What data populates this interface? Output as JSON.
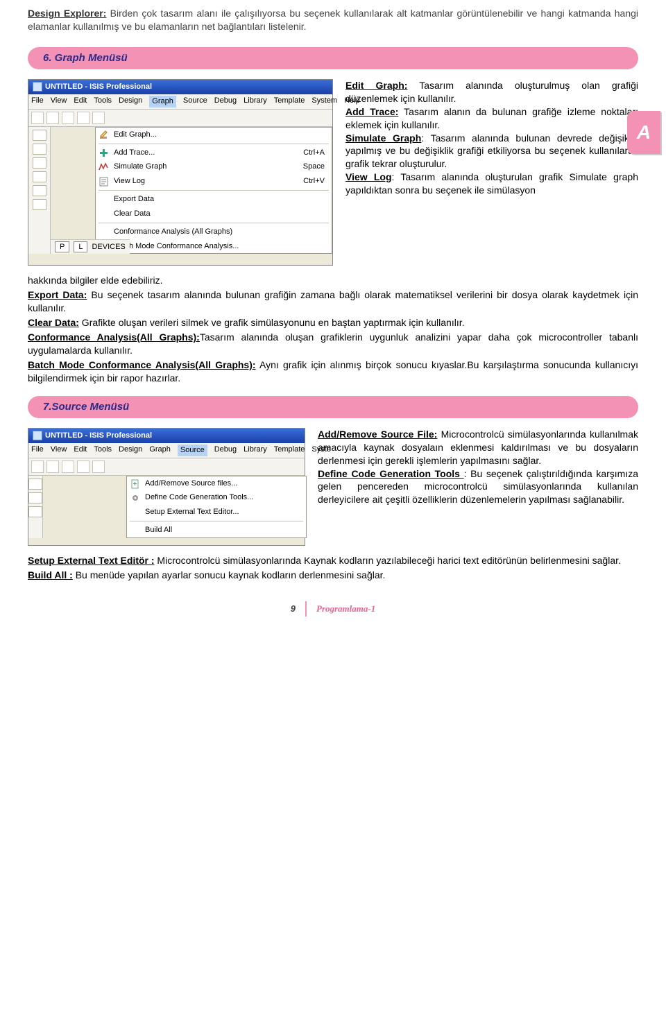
{
  "intro": {
    "term": "Design Explorer:",
    "text": " Birden çok tasarım alanı ile çalışılıyorsa  bu seçenek kullanılarak alt katmanlar görüntülenebilir ve hangi katmanda hangi elamanlar kullanılmış  ve bu elamanların net bağlantıları listelenir."
  },
  "tabA": "A",
  "section6": {
    "heading": "6. Graph  Menüsü",
    "screenshot": {
      "title": "UNTITLED - ISIS Professional",
      "menus": [
        "File",
        "View",
        "Edit",
        "Tools",
        "Design",
        "Graph",
        "Source",
        "Debug",
        "Library",
        "Template",
        "System",
        "Help"
      ],
      "menuSelected": "Graph",
      "dropdown": [
        {
          "icon": "edit",
          "label": "Edit Graph...",
          "shortcut": ""
        },
        {
          "sep": true
        },
        {
          "icon": "plus",
          "label": "Add Trace...",
          "shortcut": "Ctrl+A"
        },
        {
          "icon": "sim",
          "label": "Simulate Graph",
          "shortcut": "Space"
        },
        {
          "icon": "log",
          "label": "View Log",
          "shortcut": "Ctrl+V"
        },
        {
          "sep": true
        },
        {
          "icon": "",
          "label": "Export Data",
          "shortcut": ""
        },
        {
          "icon": "",
          "label": "Clear Data",
          "shortcut": ""
        },
        {
          "sep": true
        },
        {
          "icon": "",
          "label": "Conformance Analysis (All Graphs)",
          "shortcut": ""
        },
        {
          "icon": "",
          "label": "Batch Mode Conformance Analysis...",
          "shortcut": ""
        }
      ],
      "dev_p": "P",
      "dev_l": "L",
      "dev_label": "DEVICES"
    },
    "rightDesc": {
      "p1_term": "Edit Graph:",
      "p1": " Tasarım alanında oluşturulmuş olan grafiği düzenlemek için kullanılır.",
      "p2_term": "Add Trace:",
      "p2": " Tasarım alanın da bulunan grafiğe izleme noktaları eklemek için kullanılır.",
      "p3_term": "Simulate Graph",
      "p3": ": Tasarım alanında bulunan devrede değişiklik yapılmış ve bu değişiklik grafiği etkiliyorsa bu seçenek kullanılarak grafik tekrar oluşturulur.",
      "p4_term": "View Log",
      "p4": ": Tasarım alanında oluşturulan grafik Simulate graph yapıldıktan sonra bu seçenek ile simülasyon"
    },
    "cont_line": "hakkında bilgiler elde edebiliriz.",
    "after": {
      "a1_term": "Export Data:",
      "a1": " Bu seçenek tasarım alanında bulunan grafiğin zamana bağlı olarak matematiksel verilerini bir dosya olarak kaydetmek için kullanılır.",
      "a2_term": "Clear Data:",
      "a2": " Grafikte oluşan verileri silmek ve grafik simülasyonunu en baştan yaptırmak için kullanılır.",
      "a3_term": "Conformance Analysis(All Graphs):",
      "a3": "Tasarım alanında oluşan grafiklerin uygunluk analizini yapar daha çok microcontroller tabanlı uygulamalarda kullanılır.",
      "a4_term": "Batch Mode Conformance Analysis(All Graphs):",
      "a4": " Aynı grafik için alınmış birçok sonucu kıyaslar.Bu karşılaştırma sonucunda kullanıcıyı bilgilendirmek için bir rapor hazırlar."
    }
  },
  "section7": {
    "heading": "7.Source  Menüsü",
    "screenshot": {
      "title": "UNTITLED - ISIS Professional",
      "menus": [
        "File",
        "View",
        "Edit",
        "Tools",
        "Design",
        "Graph",
        "Source",
        "Debug",
        "Library",
        "Template",
        "Syste"
      ],
      "menuSelected": "Source",
      "dropdown": [
        {
          "icon": "file",
          "label": "Add/Remove Source files...",
          "shortcut": ""
        },
        {
          "icon": "gear",
          "label": "Define Code Generation Tools...",
          "shortcut": ""
        },
        {
          "icon": "",
          "label": "Setup External Text Editor...",
          "shortcut": ""
        },
        {
          "icon": "",
          "label": "Build All",
          "shortcut": ""
        }
      ]
    },
    "rightDesc": {
      "p1_term": "Add/Remove Source File:",
      "p1": " Microcontrolcü simülasyonlarında kullanılmak amacıyla kaynak dosyalaın eklenmesi kaldırılması ve bu dosyaların derlenmesi için gerekli işlemlerin yapılmasını sağlar.",
      "p2_term": "Define Code Generation Tools ",
      "p2": ": Bu seçenek çalıştırıldığında karşımıza gelen pencereden microcontrolcü simülasyonlarında kullanılan derleyicilere ait çeşitli özelliklerin düzenlemelerin yapılması sağlanabilir."
    },
    "after": {
      "a1_term": "Setup External Text Editör :",
      "a1": "  Microcontrolcü simülasyonlarında Kaynak kodların yazılabileceği harici text editörünün belirlenmesini sağlar.",
      "a2_term": "Build All :",
      "a2": "  Bu menüde yapılan ayarlar sonucu kaynak kodların derlenmesini sağlar."
    }
  },
  "footer": {
    "page": "9",
    "book": "Programlama-1"
  }
}
